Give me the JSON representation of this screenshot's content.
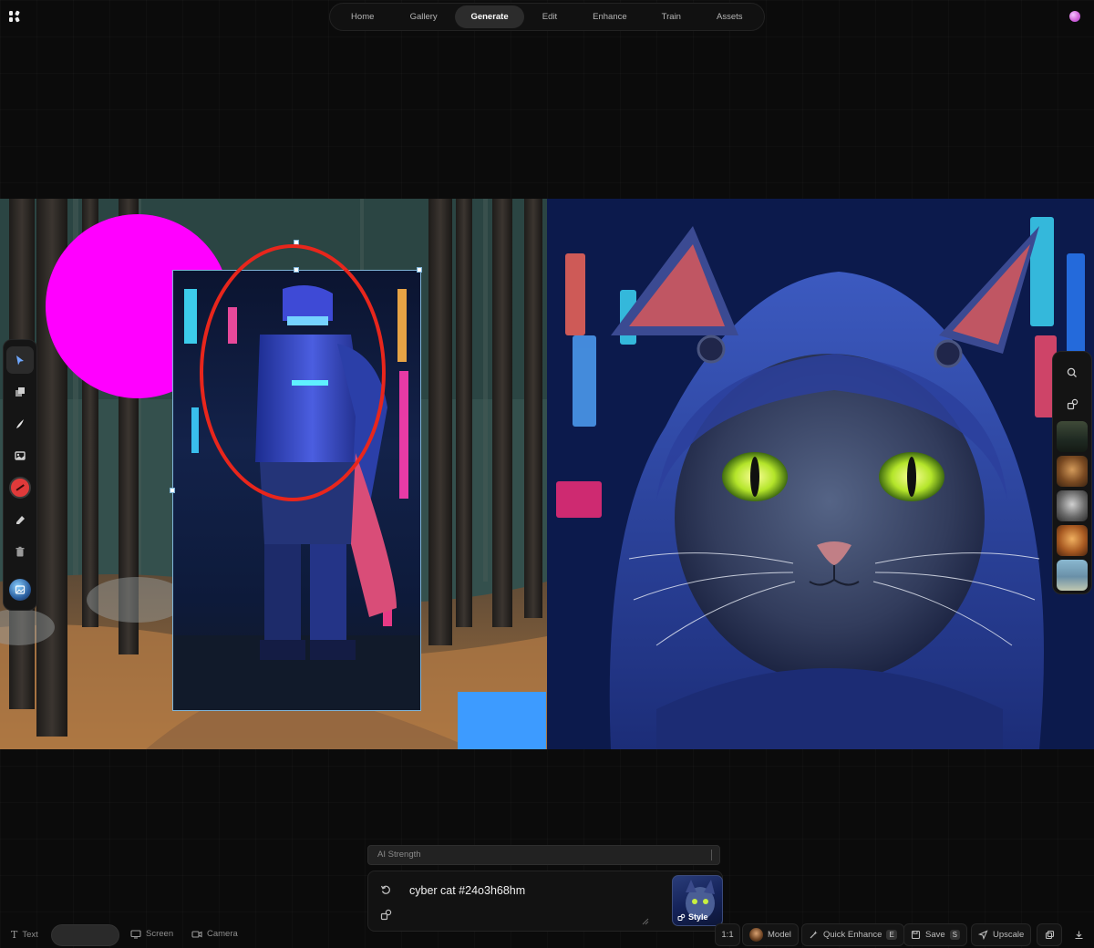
{
  "app": {
    "logo": "krea-logo-icon"
  },
  "nav": {
    "items": [
      {
        "label": "Home"
      },
      {
        "label": "Gallery"
      },
      {
        "label": "Generate",
        "active": true
      },
      {
        "label": "Edit"
      },
      {
        "label": "Enhance"
      },
      {
        "label": "Train"
      },
      {
        "label": "Assets"
      }
    ]
  },
  "canvas": {
    "shapes": {
      "circle_color": "#ff00ff",
      "square_color": "#3d9bff",
      "ellipse_stroke": "#e8261c"
    }
  },
  "left_tools": [
    "select-arrow-icon",
    "layers-icon",
    "brush-icon",
    "image-icon",
    "color-picker-icon",
    "eraser-icon",
    "trash-icon",
    "image-upload-icon"
  ],
  "right_tools": {
    "icons": [
      "search-icon",
      "shape-style-icon"
    ],
    "thumbnails": 5
  },
  "prompt": {
    "strength_label": "AI Strength",
    "text": "cyber cat #24o3h68hm",
    "style_label": "Style"
  },
  "bottom_left": {
    "text_label": "Text",
    "screen_label": "Screen",
    "camera_label": "Camera"
  },
  "bottom_right": {
    "ratio_label": "1:1",
    "model_label": "Model",
    "enhance_label": "Quick Enhance",
    "enhance_key": "E",
    "save_label": "Save",
    "save_key": "S",
    "upscale_label": "Upscale"
  },
  "colors": {
    "accent": "#e8261c",
    "brand_dot": "#d05fd6",
    "background": "#0b0b0b"
  }
}
